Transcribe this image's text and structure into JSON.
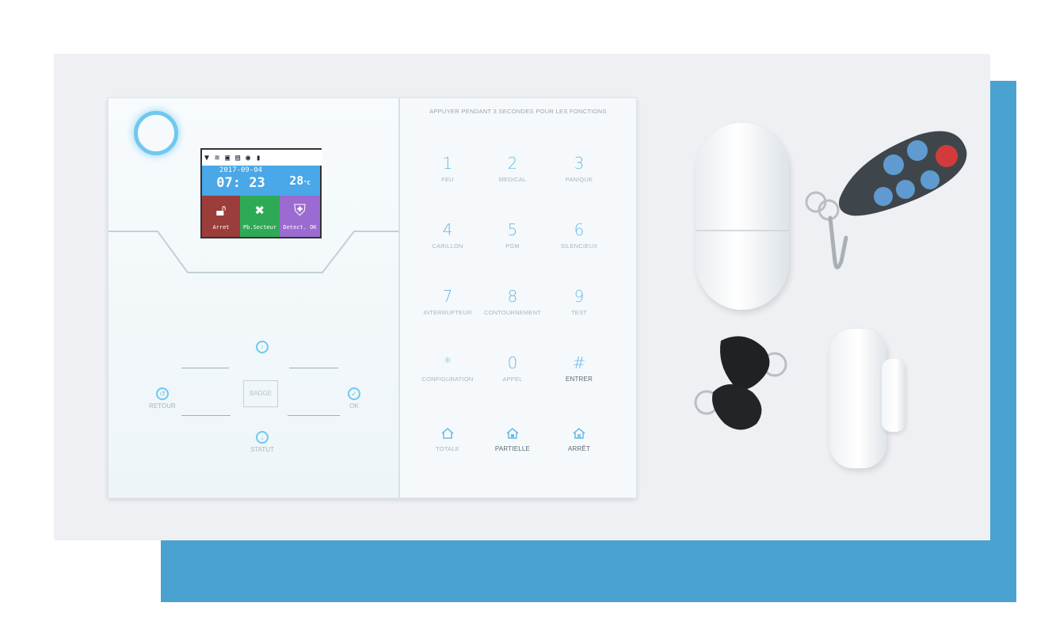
{
  "keypad": {
    "header": "APPUYER PENDANT 3 SECONDES POUR LES FONCTIONS",
    "keys": [
      {
        "digit": "1",
        "label": "FEU"
      },
      {
        "digit": "2",
        "label": "MEDICAL"
      },
      {
        "digit": "3",
        "label": "PANIQUE"
      },
      {
        "digit": "4",
        "label": "CARILLON"
      },
      {
        "digit": "5",
        "label": "PGM"
      },
      {
        "digit": "6",
        "label": "SILENCIEUX"
      },
      {
        "digit": "7",
        "label": "INTERRUPTEUR"
      },
      {
        "digit": "8",
        "label": "CONTOURNEMENT"
      },
      {
        "digit": "9",
        "label": "TEST"
      },
      {
        "digit": "*",
        "label": "CONFIGURATION"
      },
      {
        "digit": "0",
        "label": "APPEL"
      },
      {
        "digit": "#",
        "label": "ENTRER"
      }
    ],
    "modes": [
      {
        "label": "TOTALE"
      },
      {
        "label": "PARTIELLE"
      },
      {
        "label": "ARRÊT"
      }
    ]
  },
  "screen": {
    "date": "2017-09-04",
    "time": "07: 23",
    "temperature": "28",
    "temperature_unit": "°C",
    "tiles": [
      {
        "label": "Arret",
        "icon": "unlock-icon"
      },
      {
        "label": "Pb.Secteur",
        "icon": "tools-icon"
      },
      {
        "label": "Detect. OK",
        "icon": "shield-check-icon"
      }
    ],
    "status_icons": [
      "signal-icon",
      "wifi-icon",
      "network-icon",
      "sim-icon",
      "cloud-icon",
      "battery-icon"
    ]
  },
  "nav": {
    "badge": "BADGE",
    "back": "RETOUR",
    "ok": "OK",
    "status": "STATUT"
  },
  "colors": {
    "accent_blue": "#4aa2d0",
    "key_blue": "#6ab9e6",
    "tile_arret": "#9a3d3b",
    "tile_secteur": "#2eaa56",
    "tile_detect": "#9b6bd1"
  }
}
